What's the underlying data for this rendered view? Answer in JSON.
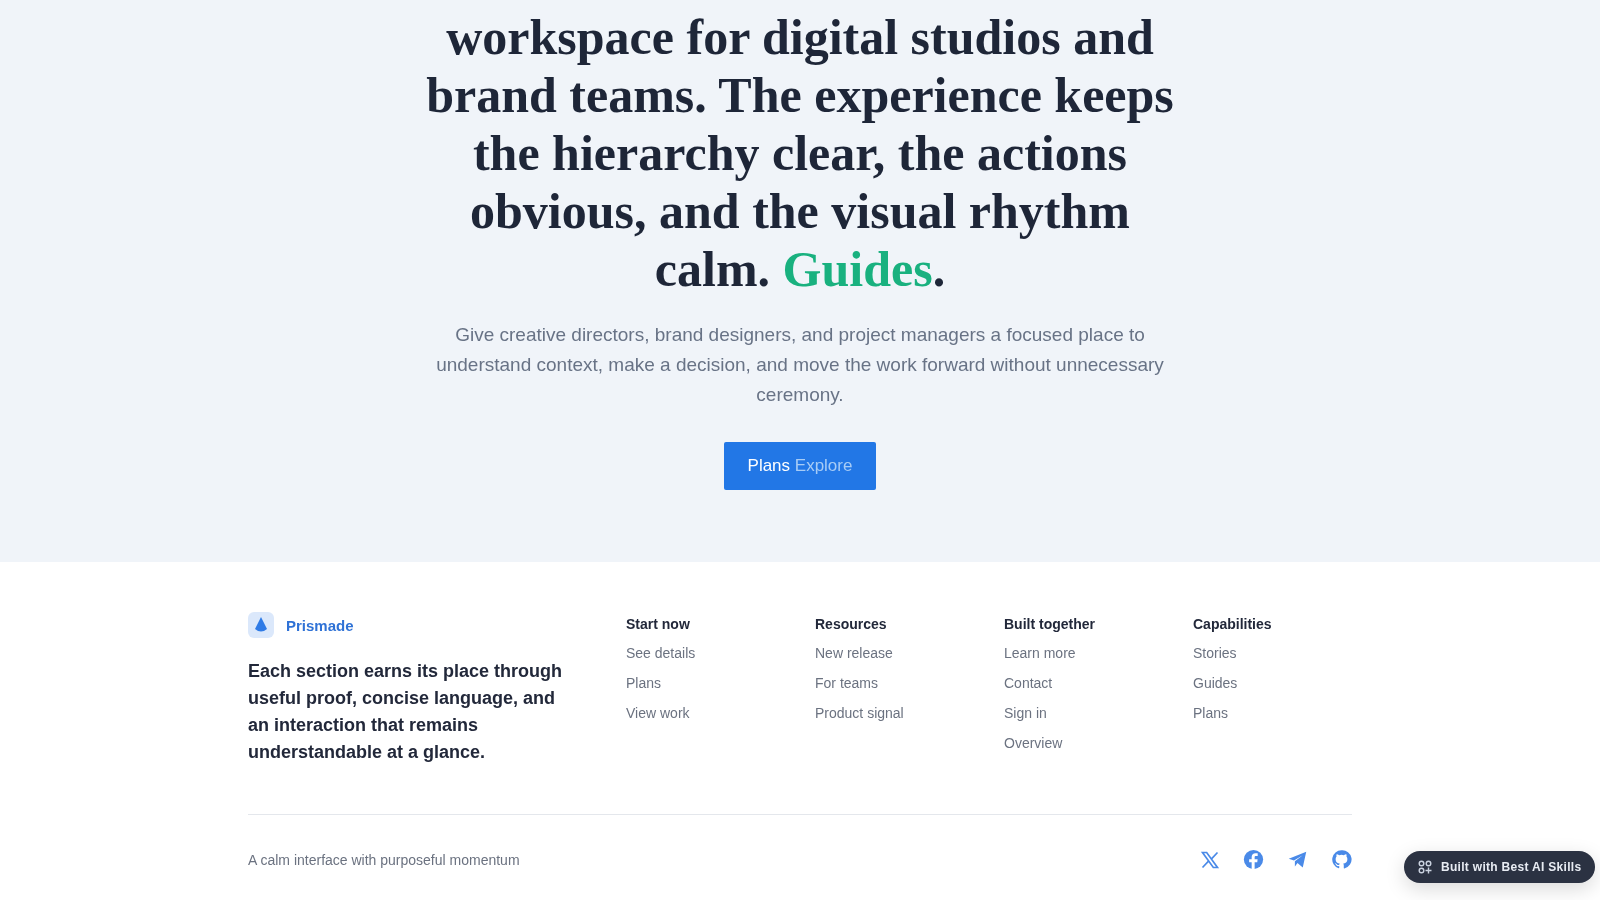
{
  "hero": {
    "headline": "workspace for digital studios and brand teams. The experience keeps the hierarchy clear, the actions obvious, and the visual rhythm calm.",
    "headline_accent": "Guides",
    "headline_end": ".",
    "lead": "Give creative directors, brand designers, and project managers a focused place to understand context, make a decision, and move the work forward without unnecessary ceremony.",
    "button": {
      "label": "Plans",
      "label_secondary": "Explore"
    }
  },
  "footer": {
    "brand": "Prismade",
    "statement": "Each section earns its place through useful proof, concise language, and an interaction that remains understandable at a glance.",
    "columns": [
      {
        "title": "Start now",
        "links": [
          "See details",
          "Plans",
          "View work"
        ]
      },
      {
        "title": "Resources",
        "links": [
          "New release",
          "For teams",
          "Product signal"
        ]
      },
      {
        "title": "Built together",
        "links": [
          "Learn more",
          "Contact",
          "Sign in",
          "Overview"
        ]
      },
      {
        "title": "Capabilities",
        "links": [
          "Stories",
          "Guides",
          "Plans"
        ]
      }
    ],
    "tagline": "A calm interface with purposeful momentum",
    "social": [
      {
        "kind": "x"
      },
      {
        "kind": "facebook"
      },
      {
        "kind": "telegram"
      },
      {
        "kind": "github"
      }
    ]
  },
  "badge": {
    "label": "Built with Best AI Skills"
  }
}
